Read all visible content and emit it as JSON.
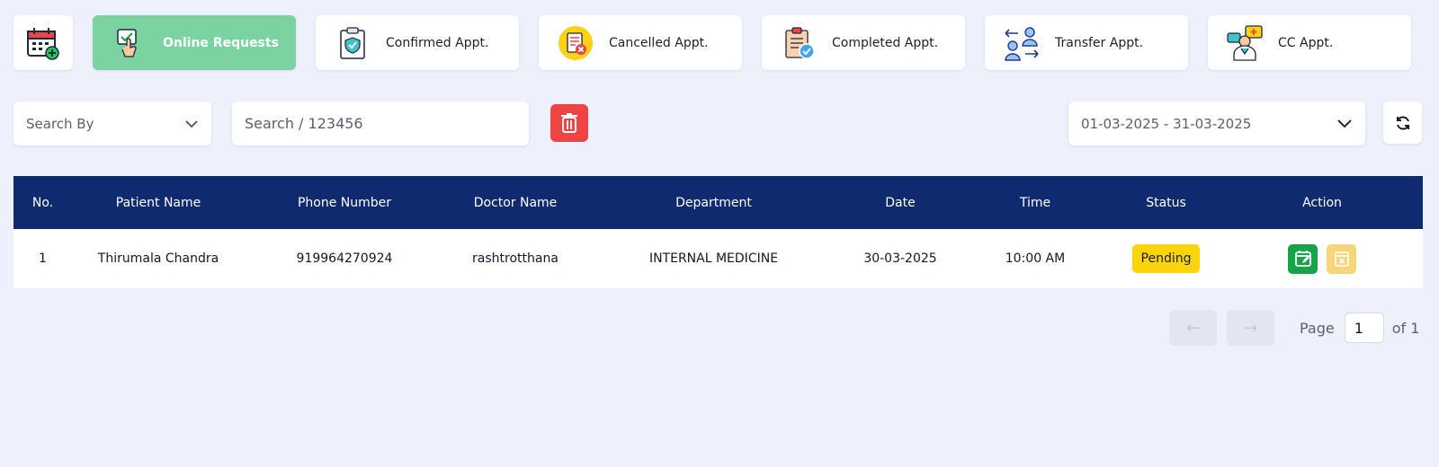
{
  "tabs": [
    {
      "label": "Online Requests",
      "icon": "online-request-icon",
      "active": true
    },
    {
      "label": "Confirmed Appt.",
      "icon": "clipboard-check-icon",
      "active": false
    },
    {
      "label": "Cancelled Appt.",
      "icon": "cancelled-document-icon",
      "active": false
    },
    {
      "label": "Completed Appt.",
      "icon": "completed-checklist-icon",
      "active": false
    },
    {
      "label": "Transfer Appt.",
      "icon": "transfer-users-icon",
      "active": false
    },
    {
      "label": "CC Appt.",
      "icon": "doctor-consult-icon",
      "active": false
    }
  ],
  "filters": {
    "search_by": "Search By",
    "search_placeholder": "Search / 123456",
    "date_range": "01-03-2025 - 31-03-2025"
  },
  "table": {
    "columns": [
      "No.",
      "Patient Name",
      "Phone Number",
      "Doctor Name",
      "Department",
      "Date",
      "Time",
      "Status",
      "Action"
    ],
    "rows": [
      {
        "no": "1",
        "patient": "Thirumala Chandra",
        "phone": "919964270924",
        "doctor": "rashtrotthana",
        "department": "INTERNAL MEDICINE",
        "date": "30-03-2025",
        "time": "10:00 AM",
        "status": "Pending"
      }
    ]
  },
  "pagination": {
    "prev": "←",
    "next": "→",
    "page_label": "Page",
    "current": "1",
    "of_label": "of 1"
  },
  "colors": {
    "header_bg": "#0f2a6e",
    "active_tab": "#7bd3a2",
    "status_pending": "#fbd40b",
    "delete": "#ef4444"
  }
}
